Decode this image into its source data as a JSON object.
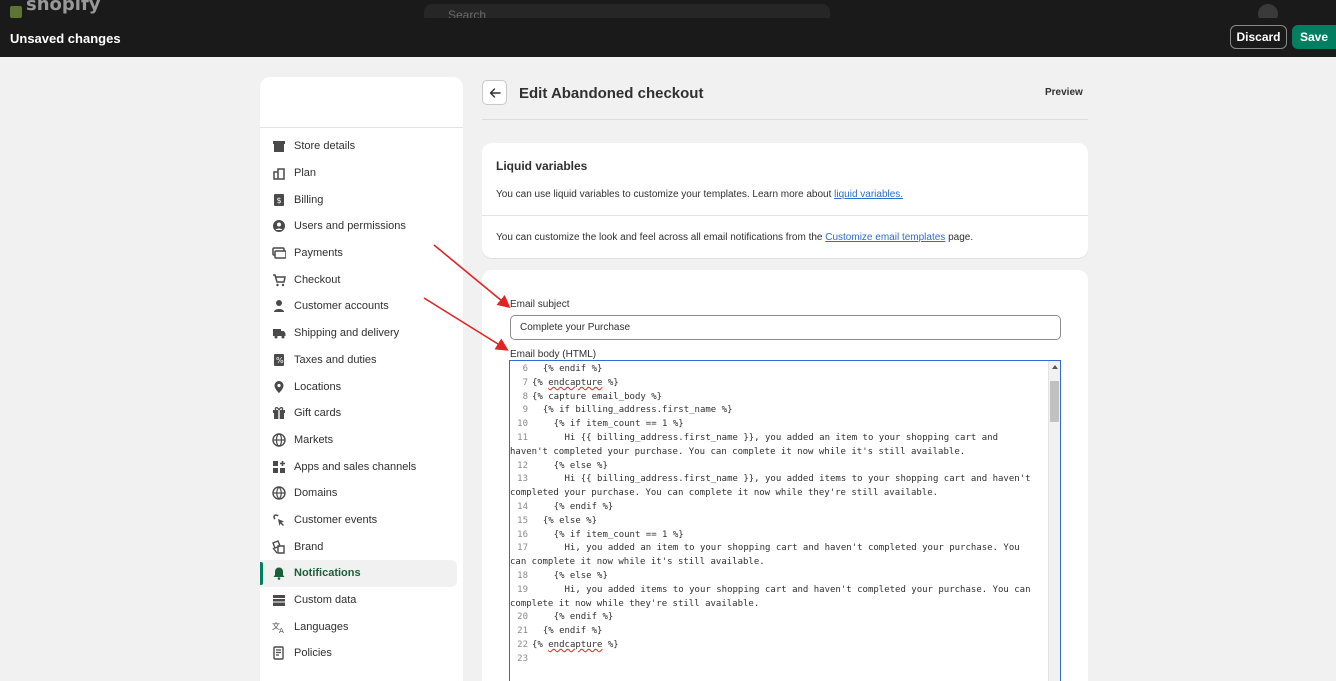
{
  "topbar": {
    "ghost_brand": "shopify",
    "ghost_search": "Search",
    "status": "Unsaved changes",
    "discard_label": "Discard",
    "save_label": "Save"
  },
  "sidebar": {
    "items": [
      {
        "label": "Store details",
        "icon": "store-icon"
      },
      {
        "label": "Plan",
        "icon": "plan-icon"
      },
      {
        "label": "Billing",
        "icon": "billing-icon"
      },
      {
        "label": "Users and permissions",
        "icon": "user-circle-icon"
      },
      {
        "label": "Payments",
        "icon": "payments-icon"
      },
      {
        "label": "Checkout",
        "icon": "cart-icon"
      },
      {
        "label": "Customer accounts",
        "icon": "person-icon"
      },
      {
        "label": "Shipping and delivery",
        "icon": "truck-icon"
      },
      {
        "label": "Taxes and duties",
        "icon": "tax-icon"
      },
      {
        "label": "Locations",
        "icon": "location-icon"
      },
      {
        "label": "Gift cards",
        "icon": "gift-icon"
      },
      {
        "label": "Markets",
        "icon": "globe-icon"
      },
      {
        "label": "Apps and sales channels",
        "icon": "apps-icon"
      },
      {
        "label": "Domains",
        "icon": "domain-icon"
      },
      {
        "label": "Customer events",
        "icon": "cursor-click-icon"
      },
      {
        "label": "Brand",
        "icon": "brand-icon"
      },
      {
        "label": "Notifications",
        "icon": "bell-icon",
        "active": true
      },
      {
        "label": "Custom data",
        "icon": "custom-data-icon"
      },
      {
        "label": "Languages",
        "icon": "language-icon"
      },
      {
        "label": "Policies",
        "icon": "policy-icon"
      }
    ]
  },
  "header": {
    "title": "Edit Abandoned checkout",
    "preview_label": "Preview"
  },
  "liquid_card": {
    "title": "Liquid variables",
    "text1": "You can use liquid variables to customize your templates. Learn more about ",
    "link1": "liquid variables.",
    "text2": "You can customize the look and feel across all email notifications from the ",
    "link2": "Customize email templates",
    "text2_end": " page."
  },
  "form": {
    "subject_label": "Email subject",
    "subject_value": "Complete your Purchase",
    "body_label": "Email body (HTML)"
  },
  "code_lines": [
    {
      "n": "6",
      "t": "  {% endif %}"
    },
    {
      "n": "7",
      "t": "{% endcapture %}",
      "sq": "endcapture"
    },
    {
      "n": "8",
      "t": "{% capture email_body %}"
    },
    {
      "n": "9",
      "t": "  {% if billing_address.first_name %}"
    },
    {
      "n": "10",
      "t": "    {% if item_count == 1 %}"
    },
    {
      "n": "11",
      "t": "      Hi {{ billing_address.first_name }}, you added an item to your shopping cart and"
    },
    {
      "n": "",
      "t": "haven't completed your purchase. You can complete it now while it's still available."
    },
    {
      "n": "12",
      "t": "    {% else %}"
    },
    {
      "n": "13",
      "t": "      Hi {{ billing_address.first_name }}, you added items to your shopping cart and haven't"
    },
    {
      "n": "",
      "t": "completed your purchase. You can complete it now while they're still available."
    },
    {
      "n": "14",
      "t": "    {% endif %}"
    },
    {
      "n": "15",
      "t": "  {% else %}"
    },
    {
      "n": "16",
      "t": "    {% if item_count == 1 %}"
    },
    {
      "n": "17",
      "t": "      Hi, you added an item to your shopping cart and haven't completed your purchase. You"
    },
    {
      "n": "",
      "t": "can complete it now while it's still available."
    },
    {
      "n": "18",
      "t": "    {% else %}"
    },
    {
      "n": "19",
      "t": "      Hi, you added items to your shopping cart and haven't completed your purchase. You can"
    },
    {
      "n": "",
      "t": "complete it now while they're still available."
    },
    {
      "n": "20",
      "t": "    {% endif %}"
    },
    {
      "n": "21",
      "t": "  {% endif %}"
    },
    {
      "n": "22",
      "t": "{% endcapture %}",
      "sq": "endcapture"
    },
    {
      "n": "23",
      "t": ""
    }
  ],
  "colors": {
    "topbar": "#1a1a1a",
    "save": "#008060",
    "link": "#2c6ecb",
    "annotation_arrow": "#e02424"
  }
}
